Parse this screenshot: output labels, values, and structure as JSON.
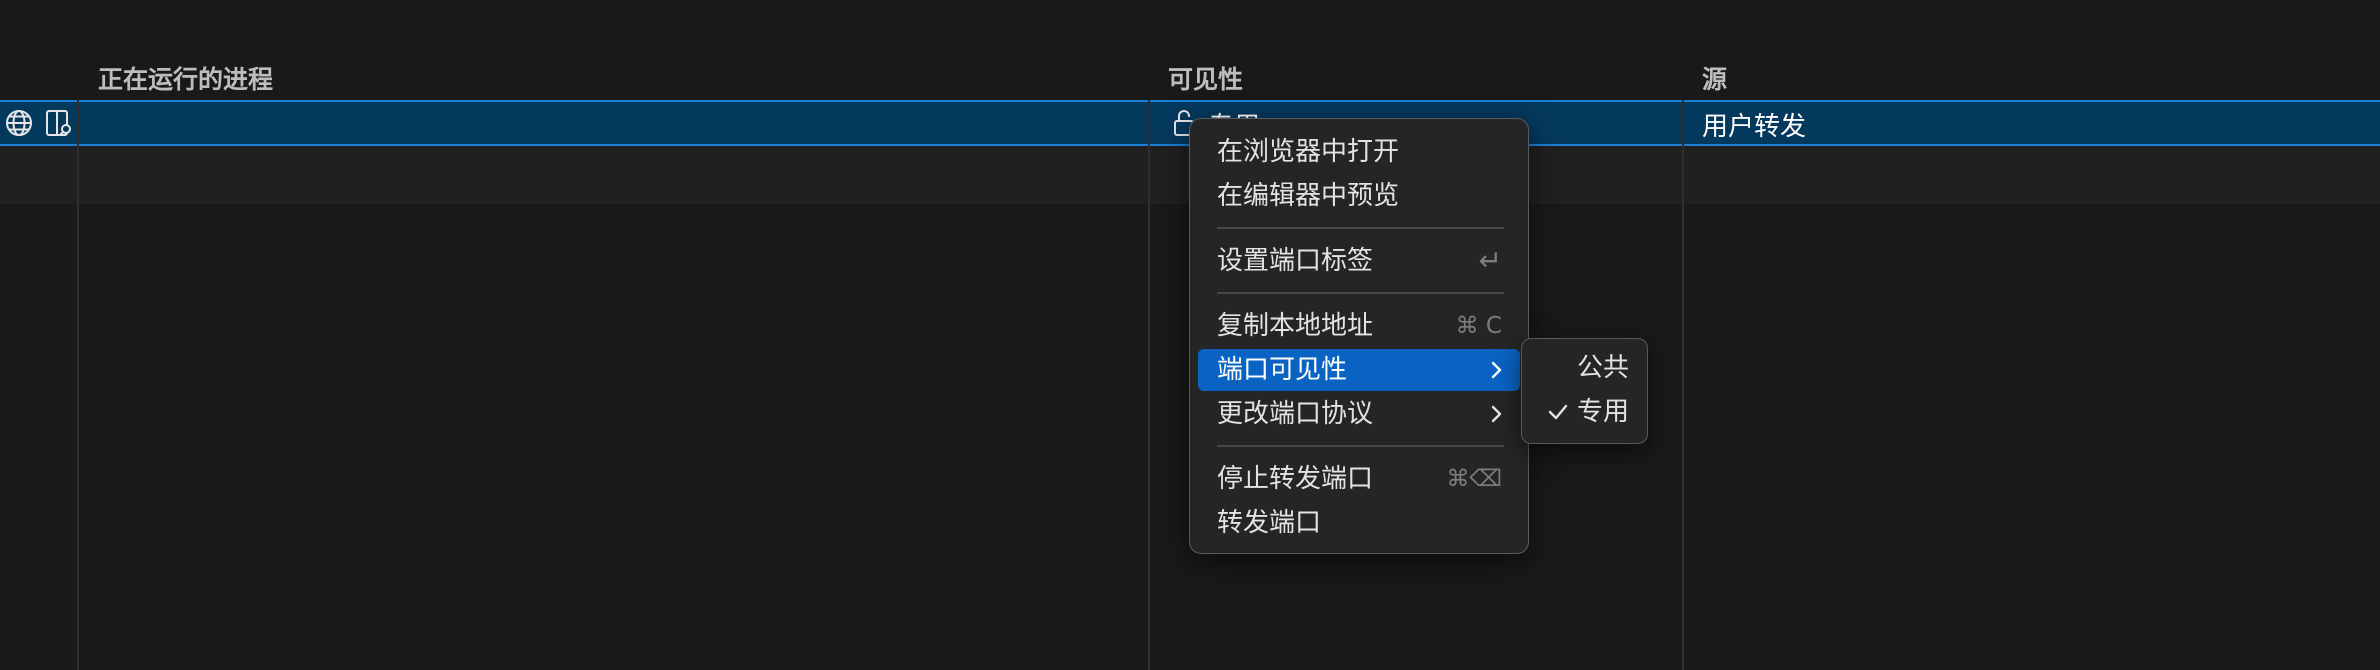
{
  "table": {
    "columns": {
      "process": "正在运行的进程",
      "visibility": "可见性",
      "origin": "源"
    },
    "selected_row": {
      "icons": [
        "globe-icon",
        "preview-icon"
      ],
      "visibility": "专用",
      "visibility_icon": "lock-open-icon",
      "origin": "用户转发"
    }
  },
  "context_menu": {
    "groups": [
      [
        {
          "label": "在浏览器中打开"
        },
        {
          "label": "在编辑器中预览"
        }
      ],
      [
        {
          "label": "设置端口标签",
          "shortcut": "↵"
        }
      ],
      [
        {
          "label": "复制本地地址",
          "shortcut": "⌘ C"
        },
        {
          "label": "端口可见性",
          "submenu": true,
          "active": true
        },
        {
          "label": "更改端口协议",
          "submenu": true
        }
      ],
      [
        {
          "label": "停止转发端口",
          "shortcut": "⌘⌫"
        },
        {
          "label": "转发端口"
        }
      ]
    ]
  },
  "visibility_submenu": {
    "items": [
      {
        "label": "公共",
        "checked": false
      },
      {
        "label": "专用",
        "checked": true
      }
    ]
  },
  "colors": {
    "background": "#191919",
    "selection": "#04395e",
    "selection_border": "#1c7fd6",
    "menu_active": "#0a63c3"
  }
}
